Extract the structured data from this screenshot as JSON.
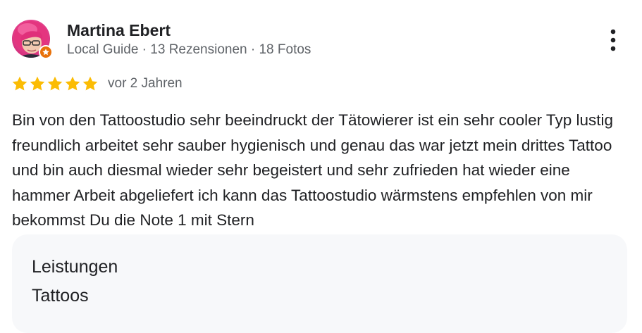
{
  "review": {
    "author": {
      "name": "Martina Ebert",
      "meta": "Local Guide · 13 Rezensionen · 18 Fotos",
      "avatar_icon": "user-avatar-photo",
      "badge_icon": "local-guide-star-icon",
      "badge_color": "#e8710a"
    },
    "menu_icon": "more-vert-icon",
    "rating": {
      "stars": 5,
      "max": 5,
      "star_color": "#fbbc04"
    },
    "date": "vor 2 Jahren",
    "text": "Bin von den Tattoostudio sehr beeindruckt der Tätowierer ist ein sehr cooler Typ lustig freundlich arbeitet sehr sauber hygienisch und genau das war jetzt mein drittes Tattoo und bin auch diesmal wieder sehr begeistert und sehr zufrieden hat wieder eine hammer Arbeit abgeliefert ich kann das Tattoostudio wärmstens empfehlen von mir bekommst Du die Note 1 mit Stern",
    "details": {
      "title": "Leistungen",
      "value": "Tattoos"
    }
  }
}
